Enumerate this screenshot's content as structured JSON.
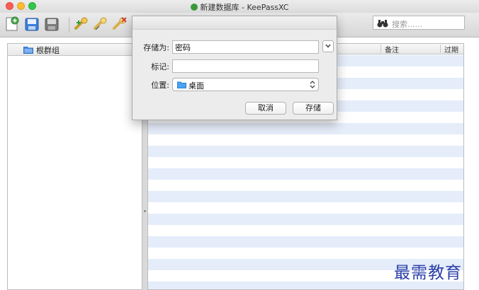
{
  "window": {
    "title": "新建数据库 - KeePassXC"
  },
  "toolbar": {
    "buttons": [
      "new-database-icon",
      "open-database-icon",
      "save-database-icon",
      "add-entry-icon",
      "edit-entry-icon",
      "delete-entry-icon"
    ],
    "search_placeholder": "搜索......"
  },
  "groups": {
    "root_label": "根群组"
  },
  "entries": {
    "columns": {
      "notes": "备注",
      "expires": "过期"
    }
  },
  "dialog": {
    "save_as_label": "存储为:",
    "save_as_value": "密码",
    "tags_label": "标记:",
    "tags_value": "",
    "location_label": "位置:",
    "location_value": "桌面",
    "cancel_label": "取消",
    "save_label": "存储"
  },
  "watermark": {
    "text": "最需教育"
  },
  "colors": {
    "accent": "#3d8ee8",
    "stripe": "#e5ecfa",
    "watermark": "#2a3fa8"
  }
}
